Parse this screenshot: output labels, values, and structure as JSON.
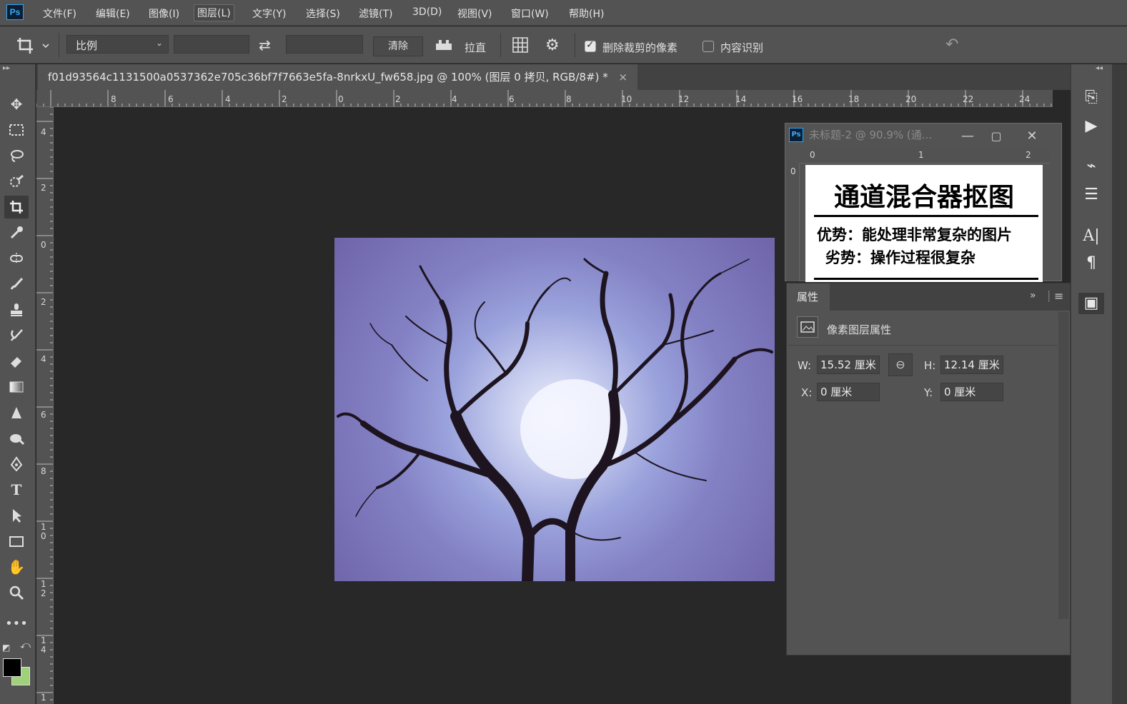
{
  "app": {
    "logo": "Ps"
  },
  "menu": [
    "文件(F)",
    "编辑(E)",
    "图像(I)",
    "图层(L)",
    "文字(Y)",
    "选择(S)",
    "滤镜(T)",
    "3D(D)",
    "视图(V)",
    "窗口(W)",
    "帮助(H)"
  ],
  "options": {
    "ratio_select": "比例",
    "clear_button": "清除",
    "straighten_label": "拉直",
    "delete_cropped_label": "删除裁剪的像素",
    "delete_cropped_checked": true,
    "content_aware_label": "内容识别",
    "content_aware_checked": false
  },
  "document": {
    "tab_title": "f01d93564c1131500a0537362e705c36bf7f7663e5fa-8nrkxU_fw658.jpg @ 100% (图层 0 拷贝, RGB/8#) *",
    "close": "×",
    "h_ruler": [
      "8",
      "6",
      "4",
      "2",
      "0",
      "2",
      "4",
      "6",
      "8",
      "10",
      "12",
      "14",
      "16",
      "18",
      "20",
      "22",
      "24"
    ],
    "v_ruler": [
      "4",
      "2",
      "0",
      "2",
      "4",
      "6",
      "8",
      "1\n0",
      "1\n2",
      "1\n4",
      "1"
    ]
  },
  "float_window": {
    "title": "未标题-2 @ 90.9% (通...",
    "logo": "Ps",
    "ruler_h": [
      "0",
      "1",
      "2"
    ],
    "ruler_v": [
      "0"
    ],
    "content_title": "通道混合器抠图",
    "advantage": "优势：能处理非常复杂的图片",
    "disadvantage": "劣势：操作过程很复杂"
  },
  "properties": {
    "tab": "属性",
    "section": "像素图层属性",
    "w_label": "W:",
    "w_value": "15.52 厘米",
    "h_label": "H:",
    "h_value": "12.14 厘米",
    "x_label": "X:",
    "x_value": "0 厘米",
    "y_label": "Y:",
    "y_value": "0 厘米"
  },
  "colors": {
    "foreground": "#000000",
    "background": "#9fd17a",
    "accent": "#2fa3f7"
  }
}
